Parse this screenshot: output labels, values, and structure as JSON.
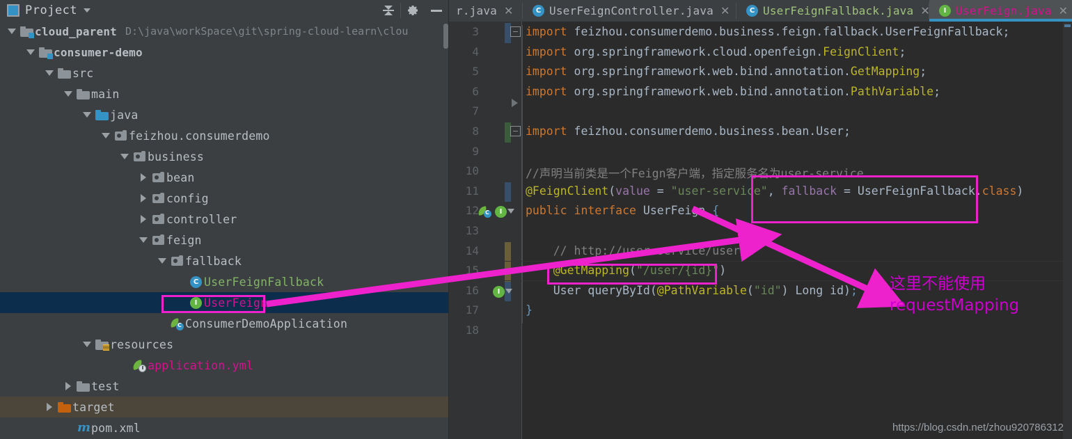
{
  "project_panel": {
    "title": "Project",
    "title_icon": "project-window-icon",
    "toolbar": {
      "collapse_all": "collapse-all-icon",
      "settings": "gear-icon",
      "hide": "minimize-icon"
    },
    "tree": [
      {
        "label": "cloud_parent",
        "path": "D:\\java\\workSpace\\git\\spring-cloud-learn\\clou",
        "indent": 0,
        "arrow": "down",
        "icon": "module-folder-icon",
        "style": "bold"
      },
      {
        "label": "consumer-demo",
        "path": "",
        "indent": 1,
        "arrow": "down",
        "icon": "module-folder-icon",
        "style": "bold"
      },
      {
        "label": "src",
        "path": "",
        "indent": 2,
        "arrow": "down",
        "icon": "folder-icon",
        "style": "normal"
      },
      {
        "label": "main",
        "path": "",
        "indent": 3,
        "arrow": "down",
        "icon": "folder-icon",
        "style": "normal"
      },
      {
        "label": "java",
        "path": "",
        "indent": 4,
        "arrow": "down",
        "icon": "source-folder-icon",
        "style": "normal"
      },
      {
        "label": "feizhou.consumerdemo",
        "path": "",
        "indent": 5,
        "arrow": "down",
        "icon": "package-icon",
        "style": "normal"
      },
      {
        "label": "business",
        "path": "",
        "indent": 6,
        "arrow": "down",
        "icon": "package-icon",
        "style": "normal"
      },
      {
        "label": "bean",
        "path": "",
        "indent": 7,
        "arrow": "right",
        "icon": "package-icon",
        "style": "normal"
      },
      {
        "label": "config",
        "path": "",
        "indent": 7,
        "arrow": "right",
        "icon": "package-icon",
        "style": "normal"
      },
      {
        "label": "controller",
        "path": "",
        "indent": 7,
        "arrow": "right",
        "icon": "package-icon",
        "style": "normal"
      },
      {
        "label": "feign",
        "path": "",
        "indent": 7,
        "arrow": "down",
        "icon": "package-icon",
        "style": "normal"
      },
      {
        "label": "fallback",
        "path": "",
        "indent": 8,
        "arrow": "down",
        "icon": "package-icon",
        "style": "normal"
      },
      {
        "label": "UserFeignFallback",
        "path": "",
        "indent": 9,
        "arrow": "none",
        "icon": "java-class-icon",
        "style": "green"
      },
      {
        "label": "UserFeign",
        "path": "",
        "indent": 9,
        "arrow": "none",
        "icon": "java-interface-icon",
        "style": "magenta",
        "selected": true
      },
      {
        "label": "ConsumerDemoApplication",
        "path": "",
        "indent": 8,
        "arrow": "none",
        "icon": "spring-boot-class-icon",
        "style": "normal"
      },
      {
        "label": "resources",
        "path": "",
        "indent": 4,
        "arrow": "down",
        "icon": "resources-folder-icon",
        "style": "normal"
      },
      {
        "label": "application.yml",
        "path": "",
        "indent": 6,
        "arrow": "none",
        "icon": "spring-yaml-icon",
        "style": "magenta"
      },
      {
        "label": "test",
        "path": "",
        "indent": 3,
        "arrow": "right",
        "icon": "folder-icon",
        "style": "normal"
      },
      {
        "label": "target",
        "path": "",
        "indent": 2,
        "arrow": "right",
        "icon": "excluded-folder-icon",
        "style": "normal",
        "excluded": true
      },
      {
        "label": "pom.xml",
        "path": "",
        "indent": 3,
        "arrow": "none",
        "icon": "maven-icon",
        "style": "normal"
      }
    ]
  },
  "tabs": [
    {
      "label": "r.java",
      "icon": "",
      "active": false,
      "truncated": true
    },
    {
      "label": "UserFeignController.java",
      "icon": "java-class-icon",
      "active": false
    },
    {
      "label": "UserFeignFallback.java",
      "icon": "java-class-icon",
      "active": false,
      "style": "green"
    },
    {
      "label": "UserFeign.java",
      "icon": "java-interface-icon",
      "active": true,
      "style": "magenta"
    }
  ],
  "editor": {
    "first_line": 3,
    "last_line": 18,
    "line_numbers": [
      3,
      4,
      5,
      6,
      7,
      8,
      9,
      10,
      11,
      12,
      13,
      14,
      15,
      16,
      17,
      18
    ],
    "lines": [
      {
        "n": 3,
        "text": "import feizhou.consumerdemo.business.feign.fallback.UserFeignFallback;"
      },
      {
        "n": 4,
        "text": "import org.springframework.cloud.openfeign.FeignClient;"
      },
      {
        "n": 5,
        "text": "import org.springframework.web.bind.annotation.GetMapping;"
      },
      {
        "n": 6,
        "text": "import org.springframework.web.bind.annotation.PathVariable;"
      },
      {
        "n": 7,
        "text": ""
      },
      {
        "n": 8,
        "text": "import feizhou.consumerdemo.business.bean.User;"
      },
      {
        "n": 9,
        "text": ""
      },
      {
        "n": 10,
        "text": "//声明当前类是一个Feign客户端，指定服务名为user-service"
      },
      {
        "n": 11,
        "text": "@FeignClient(value = \"user-service\", fallback = UserFeignFallback.class)"
      },
      {
        "n": 12,
        "text": "public interface UserFeign {"
      },
      {
        "n": 13,
        "text": ""
      },
      {
        "n": 14,
        "text": "    // http://user-service/user/1"
      },
      {
        "n": 15,
        "text": "    @GetMapping(\"/user/{id}\")"
      },
      {
        "n": 16,
        "text": "    User queryById(@PathVariable(\"id\") Long id);"
      },
      {
        "n": 17,
        "text": "}"
      },
      {
        "n": 18,
        "text": ""
      }
    ],
    "gutter_icons": [
      {
        "line": 12,
        "icon": "spring-bean-gutter-icon"
      },
      {
        "line": 12,
        "icon": "implemented-interface-gutter-icon"
      },
      {
        "line": 16,
        "icon": "implemented-method-gutter-icon"
      }
    ]
  },
  "annotations": {
    "note_line1": "这里不能使用",
    "note_line2": "requestMapping",
    "highlight_color": "#ee22cc",
    "boxes": [
      {
        "name": "fallback-highlight-box"
      },
      {
        "name": "getmapping-highlight-box"
      },
      {
        "name": "userfeign-tree-highlight-box"
      }
    ]
  },
  "watermark": "https://blog.csdn.net/zhou920786312"
}
